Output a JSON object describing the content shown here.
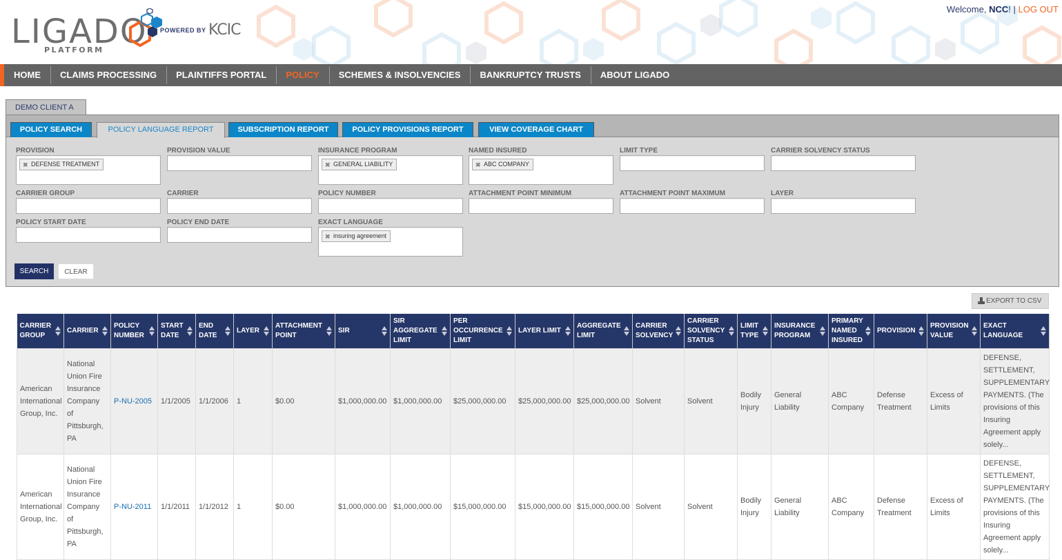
{
  "header": {
    "logo_text": "LIGADO",
    "logo_sub": "PLATFORM",
    "powered_by": "POWERED BY",
    "kcic": "KCIC",
    "welcome_prefix": "Welcome, ",
    "user": "NCC",
    "welcome_suffix": "!",
    "separator": " | ",
    "logout": "LOG OUT"
  },
  "colors": {
    "accent": "#f26522",
    "nav_bg": "#636363",
    "tab_blue": "#0b86c8",
    "table_header": "#253668",
    "search_button": "#233266",
    "link": "#1a6eb0"
  },
  "nav": {
    "items": [
      {
        "label": "HOME"
      },
      {
        "label": "CLAIMS PROCESSING"
      },
      {
        "label": "PLAINTIFFS PORTAL"
      },
      {
        "label": "POLICY",
        "active": true
      },
      {
        "label": "SCHEMES & INSOLVENCIES"
      },
      {
        "label": "BANKRUPTCY TRUSTS"
      },
      {
        "label": "ABOUT LIGADO"
      }
    ]
  },
  "client_tab": "DEMO CLIENT A",
  "subtabs": [
    {
      "label": "POLICY SEARCH"
    },
    {
      "label": "POLICY LANGUAGE REPORT",
      "active": true
    },
    {
      "label": "SUBSCRIPTION REPORT"
    },
    {
      "label": "POLICY PROVISIONS REPORT"
    },
    {
      "label": "VIEW COVERAGE CHART"
    }
  ],
  "filters": {
    "provision": {
      "label": "PROVISION",
      "chips": [
        "DEFENSE TREATMENT"
      ]
    },
    "provision_value": {
      "label": "PROVISION VALUE",
      "value": ""
    },
    "insurance_program": {
      "label": "INSURANCE PROGRAM",
      "chips": [
        "GENERAL LIABILITY"
      ]
    },
    "named_insured": {
      "label": "NAMED INSURED",
      "chips": [
        "ABC COMPANY"
      ]
    },
    "limit_type": {
      "label": "LIMIT TYPE",
      "value": ""
    },
    "carrier_solvency_status": {
      "label": "CARRIER SOLVENCY STATUS",
      "value": ""
    },
    "carrier_group": {
      "label": "CARRIER GROUP",
      "value": ""
    },
    "carrier": {
      "label": "CARRIER",
      "value": ""
    },
    "policy_number": {
      "label": "POLICY NUMBER",
      "value": ""
    },
    "attachment_point_minimum": {
      "label": "ATTACHMENT POINT MINIMUM",
      "value": ""
    },
    "attachment_point_maximum": {
      "label": "ATTACHMENT POINT MAXIMUM",
      "value": ""
    },
    "layer": {
      "label": "LAYER",
      "value": ""
    },
    "policy_start_date": {
      "label": "POLICY START DATE",
      "value": ""
    },
    "policy_end_date": {
      "label": "POLICY END DATE",
      "value": ""
    },
    "exact_language": {
      "label": "EXACT LANGUAGE",
      "chips": [
        "insuring agreement"
      ]
    }
  },
  "buttons": {
    "search": "SEARCH",
    "clear": "CLEAR",
    "export": "EXPORT TO CSV"
  },
  "table": {
    "columns": [
      "CARRIER GROUP",
      "CARRIER",
      "POLICY NUMBER",
      "START DATE",
      "END DATE",
      "LAYER",
      "ATTACHMENT POINT",
      "SIR",
      "SIR AGGREGATE LIMIT",
      "PER OCCURRENCE LIMIT",
      "LAYER LIMIT",
      "AGGREGATE LIMIT",
      "CARRIER SOLVENCY",
      "CARRIER SOLVENCY STATUS",
      "LIMIT TYPE",
      "INSURANCE PROGRAM",
      "PRIMARY NAMED INSURED",
      "PROVISION",
      "PROVISION VALUE",
      "EXACT LANGUAGE"
    ],
    "rows": [
      {
        "carrier_group": "American International Group, Inc.",
        "carrier": "National Union Fire Insurance Company of Pittsburgh, PA",
        "policy_number": "P-NU-2005",
        "start_date": "1/1/2005",
        "end_date": "1/1/2006",
        "layer": "1",
        "attachment_point": "$0.00",
        "sir": "$1,000,000.00",
        "sir_aggregate_limit": "$1,000,000.00",
        "per_occurrence_limit": "$25,000,000.00",
        "layer_limit": "$25,000,000.00",
        "aggregate_limit": "$25,000,000.00",
        "carrier_solvency": "Solvent",
        "carrier_solvency_status": "Solvent",
        "limit_type": "Bodily Injury",
        "insurance_program": "General Liability",
        "primary_named_insured": "ABC Company",
        "provision": "Defense Treatment",
        "provision_value": "Excess of Limits",
        "exact_language": "DEFENSE, SETTLEMENT, SUPPLEMENTARY PAYMENTS. (The provisions of this Insuring Agreement apply solely..."
      },
      {
        "carrier_group": "American International Group, Inc.",
        "carrier": "National Union Fire Insurance Company of Pittsburgh, PA",
        "policy_number": "P-NU-2011",
        "start_date": "1/1/2011",
        "end_date": "1/1/2012",
        "layer": "1",
        "attachment_point": "$0.00",
        "sir": "$1,000,000.00",
        "sir_aggregate_limit": "$1,000,000.00",
        "per_occurrence_limit": "$15,000,000.00",
        "layer_limit": "$15,000,000.00",
        "aggregate_limit": "$15,000,000.00",
        "carrier_solvency": "Solvent",
        "carrier_solvency_status": "Solvent",
        "limit_type": "Bodily Injury",
        "insurance_program": "General Liability",
        "primary_named_insured": "ABC Company",
        "provision": "Defense Treatment",
        "provision_value": "Excess of Limits",
        "exact_language": "DEFENSE, SETTLEMENT, SUPPLEMENTARY PAYMENTS. (The provisions of this Insuring Agreement apply solely..."
      }
    ]
  }
}
